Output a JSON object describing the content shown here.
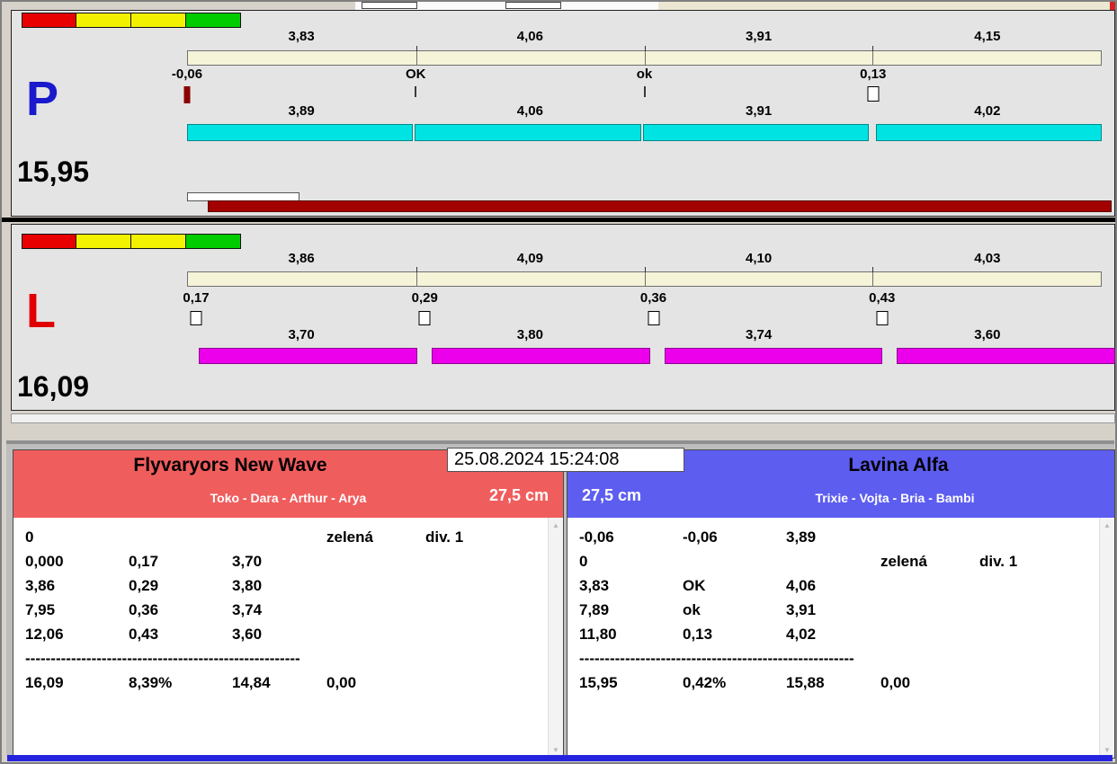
{
  "scale_colors": [
    "#e80000",
    "#f2f200",
    "#f2f200",
    "#00cc00"
  ],
  "progress_color": "#a30000",
  "panels": [
    {
      "letter": "P",
      "letter_color": "#1a1acc",
      "total": "15,95",
      "upper_values": [
        "3,83",
        "4,06",
        "3,91",
        "4,15"
      ],
      "mid_values": [
        "-0,06",
        "OK",
        "ok",
        "0,13"
      ],
      "lower_values": [
        "3,89",
        "4,06",
        "3,91",
        "4,02"
      ],
      "lower_color": "#00e3e3"
    },
    {
      "letter": "L",
      "letter_color": "#e00000",
      "total": "16,09",
      "upper_values": [
        "3,86",
        "4,09",
        "4,10",
        "4,03"
      ],
      "mid_values": [
        "0,17",
        "0,29",
        "0,36",
        "0,43"
      ],
      "lower_values": [
        "3,70",
        "3,80",
        "3,74",
        "3,60"
      ],
      "lower_color": "#ec00ec"
    }
  ],
  "datetime": "25.08.2024 15:24:08",
  "teams": [
    {
      "name": "Flyvaryors New Wave",
      "dogs": "Toko - Dara - Arthur - Arya",
      "height": "27,5 cm",
      "header_color": "#f05d5d",
      "rows": [
        [
          "0",
          "",
          "",
          "zelená",
          "div. 1"
        ],
        [
          "0,000",
          "0,17",
          "3,70",
          "",
          ""
        ],
        [
          "3,86",
          "0,29",
          "3,80",
          "",
          ""
        ],
        [
          "7,95",
          "0,36",
          "3,74",
          "",
          ""
        ],
        [
          "12,06",
          "0,43",
          "3,60",
          "",
          ""
        ]
      ],
      "separator": "------------------------------------------------------",
      "totals": [
        "16,09",
        "8,39%",
        "14,84",
        "0,00"
      ]
    },
    {
      "name": "Lavina Alfa",
      "dogs": "Trixie - Vojta - Bria - Bambi",
      "height": "27,5 cm",
      "header_color": "#5d5df0",
      "rows": [
        [
          "-0,06",
          "-0,06",
          "3,89",
          "",
          ""
        ],
        [
          "0",
          "",
          "",
          "zelená",
          "div. 1"
        ],
        [
          "3,83",
          "OK",
          "4,06",
          "",
          ""
        ],
        [
          "7,89",
          "ok",
          "3,91",
          "",
          ""
        ],
        [
          "11,80",
          "0,13",
          "4,02",
          "",
          ""
        ]
      ],
      "separator": "------------------------------------------------------",
      "totals": [
        "15,95",
        "0,42%",
        "15,88",
        "0,00"
      ]
    }
  ]
}
